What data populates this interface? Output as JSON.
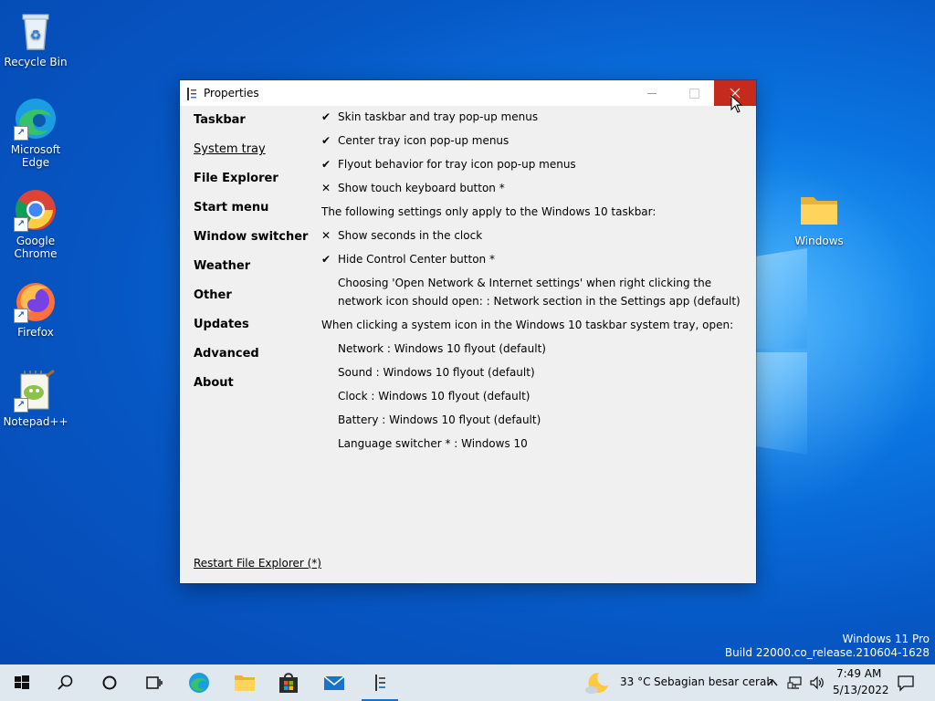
{
  "desktop": {
    "icons": [
      {
        "label": "Recycle Bin"
      },
      {
        "label": "Microsoft Edge"
      },
      {
        "label": "Google Chrome"
      },
      {
        "label": "Firefox"
      },
      {
        "label": "Notepad++"
      },
      {
        "label": "Windows"
      }
    ],
    "watermark": {
      "line1": "Windows 11 Pro",
      "line2": "Build 22000.co_release.210604-1628"
    }
  },
  "window": {
    "title": "Properties",
    "nav": [
      {
        "label": "Taskbar"
      },
      {
        "label": "System tray",
        "active": true
      },
      {
        "label": "File Explorer"
      },
      {
        "label": "Start menu"
      },
      {
        "label": "Window switcher"
      },
      {
        "label": "Weather"
      },
      {
        "label": "Other"
      },
      {
        "label": "Updates"
      },
      {
        "label": "Advanced"
      },
      {
        "label": "About"
      }
    ],
    "settings": {
      "skin_taskbar": {
        "mark": "✔",
        "label": "Skin taskbar and tray pop-up menus"
      },
      "center_tray": {
        "mark": "✔",
        "label": "Center tray icon pop-up menus"
      },
      "flyout_behavior": {
        "mark": "✔",
        "label": "Flyout behavior for tray icon pop-up menus"
      },
      "touch_keyboard": {
        "mark": "✕",
        "label": "Show touch keyboard button *"
      },
      "section_note": "The following settings only apply to the Windows 10 taskbar:",
      "show_seconds": {
        "mark": "✕",
        "label": "Show seconds in the clock"
      },
      "hide_control_center": {
        "mark": "✔",
        "label": "Hide Control Center button *"
      },
      "network_choice_line1": "Choosing 'Open Network & Internet settings' when right clicking the",
      "network_choice_line2": "network icon should open: : Network section in the Settings app (default)",
      "system_icon_note": "When clicking a system icon in the Windows 10 taskbar system tray, open:",
      "network": "Network : Windows 10 flyout (default)",
      "sound": "Sound : Windows 10 flyout (default)",
      "clock": "Clock : Windows 10 flyout (default)",
      "battery": "Battery : Windows 10 flyout (default)",
      "language": "Language switcher * : Windows 10"
    },
    "restart_link": "Restart File Explorer (*)"
  },
  "taskbar": {
    "weather_temp": "33 °C",
    "weather_text": "Sebagian besar cerah",
    "time": "7:49 AM",
    "date": "5/13/2022"
  },
  "colors": {
    "close_button": "#c42b1c",
    "taskbar_bg": "#dfe7ef",
    "desktop_blue": "#0a74e0"
  }
}
